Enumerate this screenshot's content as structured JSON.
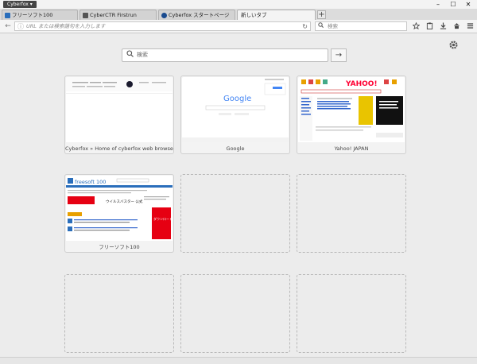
{
  "app": {
    "menu_label": "Cyberfox ▾"
  },
  "window_controls": {
    "minimize": "–",
    "maximize": "☐",
    "close": "✕"
  },
  "tabs": [
    {
      "label": "フリーソフト100",
      "active": false,
      "favicon_color": "#2a6ebb"
    },
    {
      "label": "CyberCTR Firstrun",
      "active": false,
      "favicon_color": "#555555"
    },
    {
      "label": "Cyberfox スタートページ",
      "active": false,
      "favicon_color": "#1a4b8f"
    },
    {
      "label": "新しいタブ",
      "active": true,
      "favicon_color": ""
    }
  ],
  "new_tab": "+",
  "navbar": {
    "back": "←",
    "info_icon": "ⓘ",
    "url_placeholder": "URL または検索語句を入力します",
    "reload": "↻",
    "search_placeholder": "検索",
    "toolbar_icons": [
      "star-icon",
      "clipboard-icon",
      "download-icon",
      "home-icon",
      "menu-icon"
    ]
  },
  "newtab_page": {
    "search_placeholder": "検索",
    "go": "→",
    "tiles": [
      {
        "title": "Cyberfox » Home of cyberfox web browser"
      },
      {
        "title": "Google"
      },
      {
        "title": "Yahoo! JAPAN"
      },
      {
        "title": "フリーソフト100"
      },
      {
        "title": ""
      },
      {
        "title": ""
      },
      {
        "title": ""
      },
      {
        "title": ""
      },
      {
        "title": ""
      }
    ],
    "thumbs": {
      "google_logo": "Google",
      "yahoo_logo": "YAHOO!",
      "freesoft_logo": "freesoft 100",
      "freesoft_headline": "ウイルスバスター 公式",
      "freesoft_banner": "ダウンロード"
    }
  },
  "colors": {
    "google_blue": "#4285f4",
    "google_red": "#ea4335",
    "google_yellow": "#fbbc05",
    "google_green": "#34a853",
    "yahoo_red": "#ff0033",
    "freesoft_red": "#e60012"
  }
}
